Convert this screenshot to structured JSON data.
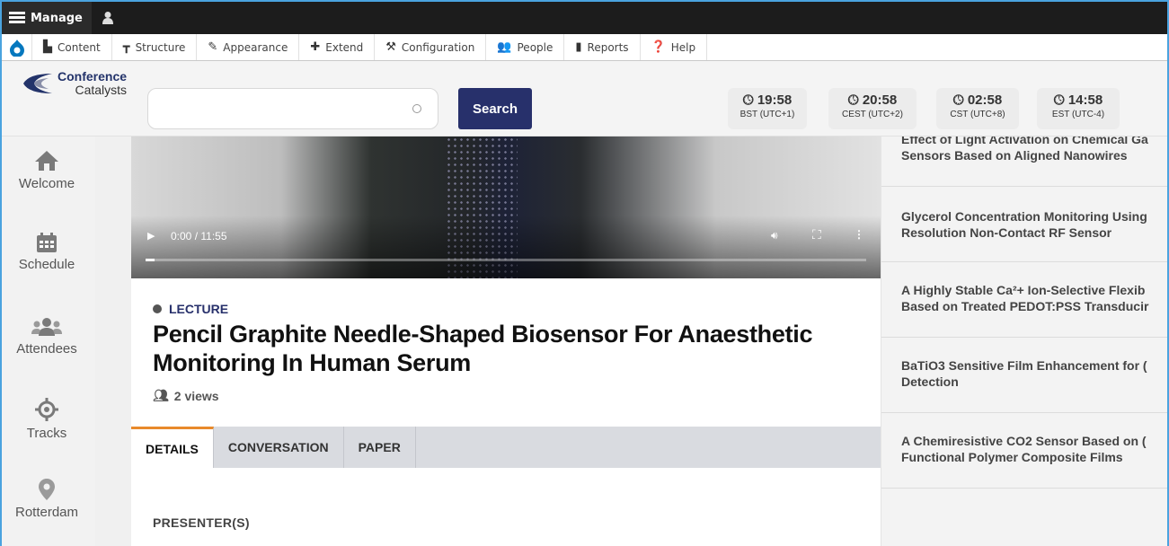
{
  "admin": {
    "manage_label": "Manage"
  },
  "toolbar": {
    "items": [
      {
        "label": "Content",
        "icon": "content-icon"
      },
      {
        "label": "Structure",
        "icon": "structure-icon"
      },
      {
        "label": "Appearance",
        "icon": "appearance-icon"
      },
      {
        "label": "Extend",
        "icon": "extend-icon"
      },
      {
        "label": "Configuration",
        "icon": "configuration-icon"
      },
      {
        "label": "People",
        "icon": "people-icon"
      },
      {
        "label": "Reports",
        "icon": "reports-icon"
      },
      {
        "label": "Help",
        "icon": "help-icon"
      }
    ]
  },
  "header": {
    "logo_line1": "Conference",
    "logo_line2": "Catalysts",
    "search_placeholder": "",
    "search_label": "Search",
    "clocks": [
      {
        "time": "19:58",
        "zone": "BST (UTC+1)"
      },
      {
        "time": "20:58",
        "zone": "CEST (UTC+2)"
      },
      {
        "time": "02:58",
        "zone": "CST (UTC+8)"
      },
      {
        "time": "14:58",
        "zone": "EST (UTC-4)"
      }
    ]
  },
  "nav": {
    "items": [
      {
        "label": "Welcome",
        "icon": "home-icon"
      },
      {
        "label": "Schedule",
        "icon": "calendar-icon"
      },
      {
        "label": "Attendees",
        "icon": "attendees-icon"
      },
      {
        "label": "Tracks",
        "icon": "tracks-icon"
      },
      {
        "label": "Rotterdam",
        "icon": "location-pin-icon"
      }
    ]
  },
  "video": {
    "time": "0:00 / 11:55",
    "progress": 0.012
  },
  "lecture": {
    "type": "LECTURE",
    "title": "Pencil Graphite Needle-Shaped Biosensor For Anaesthetic Monitoring In Human Serum",
    "views": "2 views",
    "tabs": [
      "DETAILS",
      "CONVERSATION",
      "PAPER"
    ],
    "active_tab": "DETAILS",
    "section_heading": "PRESENTER(S)"
  },
  "related": [
    {
      "line1": "Effect of Light Activation on Chemical Ga",
      "line2": "Sensors Based on Aligned Nanowires"
    },
    {
      "line1": "Glycerol Concentration Monitoring Using",
      "line2": "Resolution Non-Contact RF Sensor"
    },
    {
      "line1": "A Highly Stable Ca²+ Ion-Selective Flexib",
      "line2": "Based on Treated PEDOT:PSS Transducir"
    },
    {
      "line1": "BaTiO3 Sensitive Film Enhancement for (",
      "line2": "Detection"
    },
    {
      "line1": "A Chemiresistive CO2 Sensor Based on (",
      "line2": "Functional Polymer Composite Films"
    }
  ],
  "colors": {
    "brand_navy": "#27306b",
    "tab_accent": "#e88a2b",
    "drupal_blue": "#0678be"
  }
}
